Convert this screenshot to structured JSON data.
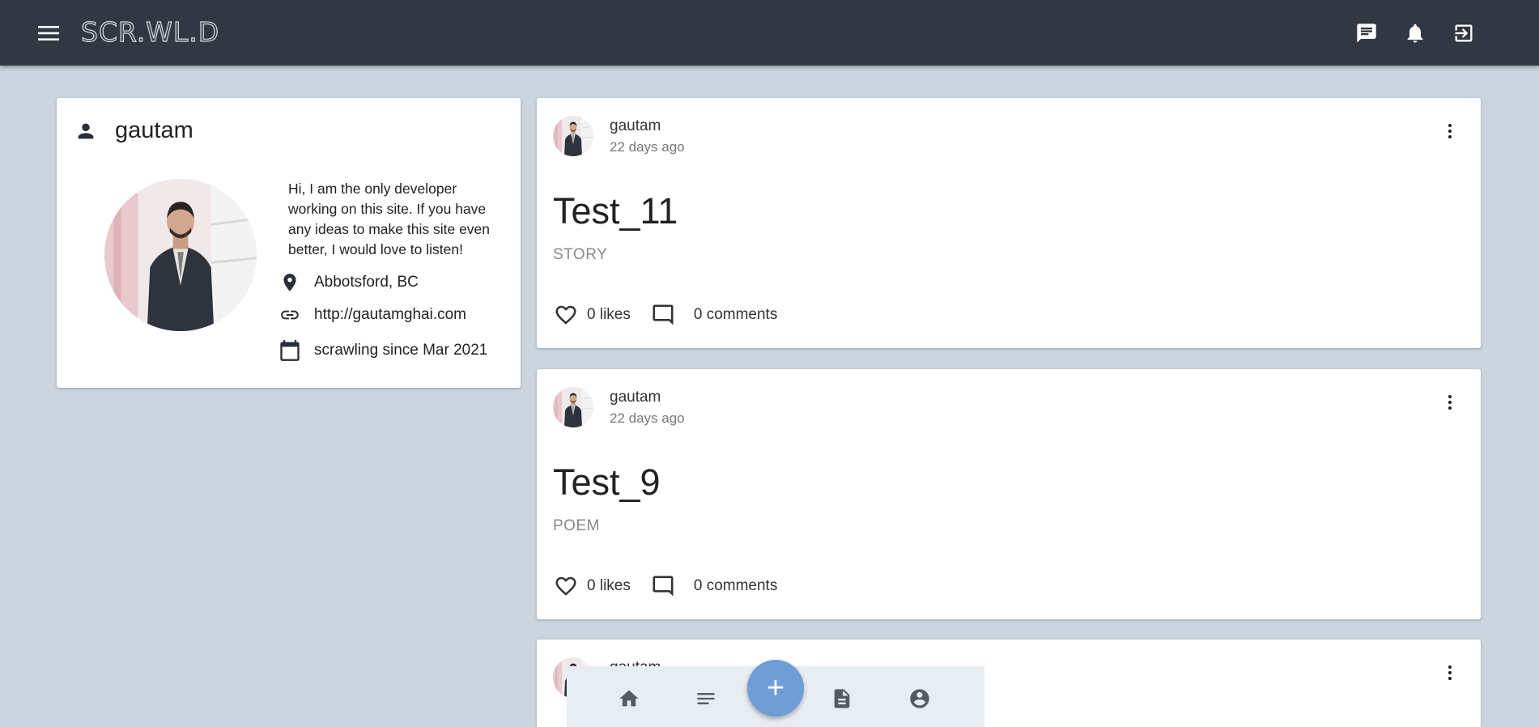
{
  "header": {
    "logo": "SCR.WL.D",
    "menu_icon": "menu-icon",
    "actions": [
      {
        "name": "messages",
        "icon": "chat-icon"
      },
      {
        "name": "notifications",
        "icon": "bell-icon"
      },
      {
        "name": "logout",
        "icon": "logout-icon"
      }
    ]
  },
  "profile": {
    "username": "gautam",
    "bio": "Hi, I am the only developer working on this site. If you have any ideas to make this site even better, I would love to listen!",
    "location": "Abbotsford, BC",
    "website": "http://gautamghai.com",
    "joined": "scrawling since Mar 2021"
  },
  "posts": [
    {
      "author": "gautam",
      "time": "22 days ago",
      "title": "Test_11",
      "genre": "STORY",
      "likes": "0 likes",
      "comments": "0 comments"
    },
    {
      "author": "gautam",
      "time": "22 days ago",
      "title": "Test_9",
      "genre": "POEM",
      "likes": "0 likes",
      "comments": "0 comments"
    },
    {
      "author": "gautam"
    }
  ],
  "bottom_nav": {
    "items": [
      {
        "name": "home",
        "icon": "home-icon"
      },
      {
        "name": "feed",
        "icon": "list-icon"
      },
      {
        "name": "drafts",
        "icon": "document-icon"
      },
      {
        "name": "profile",
        "icon": "account-icon"
      }
    ],
    "fab_label": "+"
  },
  "colors": {
    "appbar": "#313843",
    "background": "#cbd5df",
    "fab": "#6f9ed6"
  }
}
